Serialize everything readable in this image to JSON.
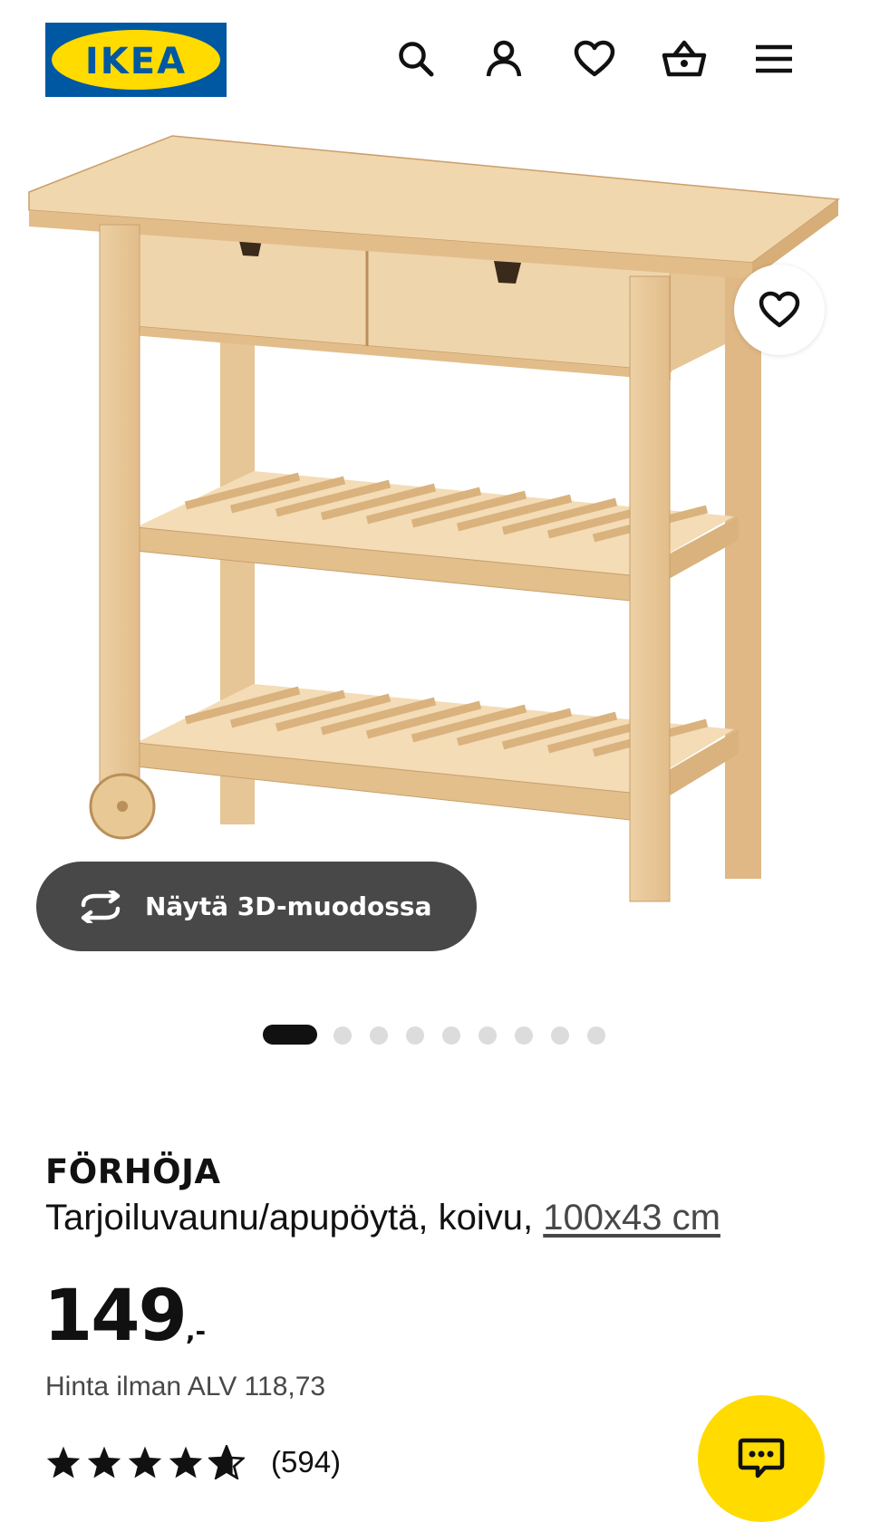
{
  "header": {
    "logo_text": "IKEA",
    "icons": [
      "search-icon",
      "account-icon",
      "heart-icon",
      "basket-icon",
      "menu-icon"
    ]
  },
  "gallery": {
    "view_3d_label": "Näytä 3D-muodossa",
    "slide_count": 9,
    "active_slide": 1
  },
  "product": {
    "name": "FÖRHÖJA",
    "description": "Tarjoiluvaunu/apupöytä, koivu, ",
    "measurement": "100x43 cm",
    "price_integer": "149",
    "price_decimals": ",-",
    "price_ex_vat": "Hinta ilman ALV 118,73",
    "rating_value": 4.7,
    "rating_max": 5,
    "review_count": "(594)"
  },
  "colors": {
    "ikea_blue": "#0058a3",
    "ikea_yellow": "#ffdb00",
    "dark_pill": "#484848",
    "wood": "#e9c89a"
  }
}
